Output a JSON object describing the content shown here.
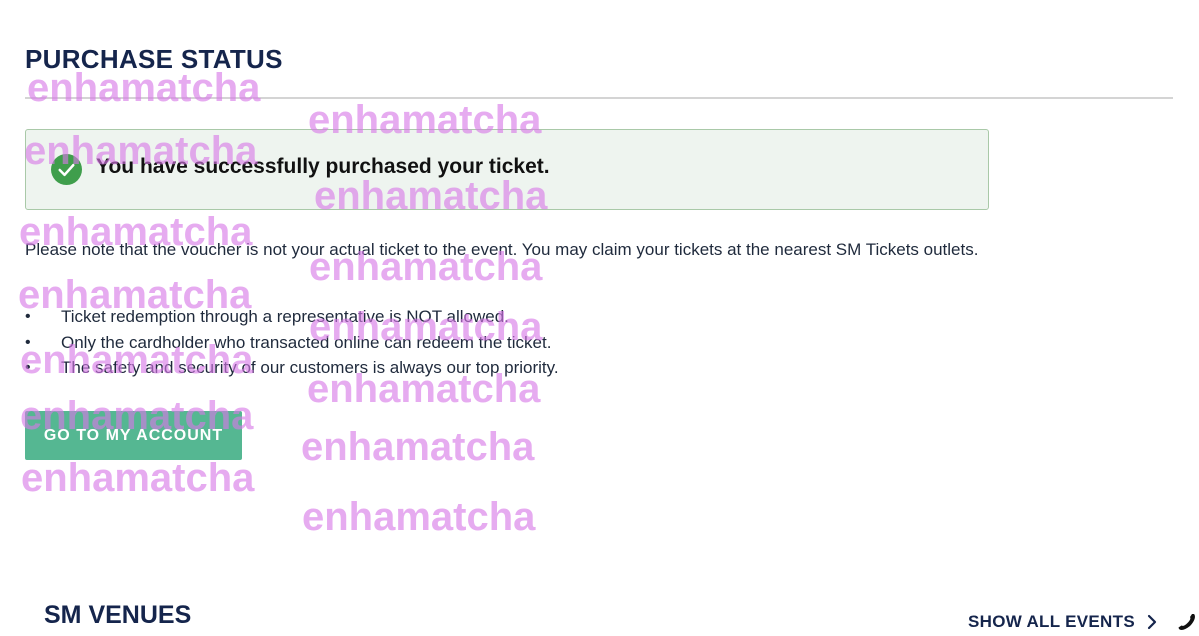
{
  "page": {
    "title": "PURCHASE STATUS"
  },
  "success": {
    "message": "You have successfully purchased your ticket.",
    "icon": "check-circle-icon",
    "color": "#3f9e4c"
  },
  "note": "Please note that the voucher is not your actual ticket to the event. You may claim your tickets at the nearest SM Tickets outlets.",
  "rules": [
    "Ticket redemption through a representative is NOT allowed.",
    "Only the cardholder who transacted online can redeem the ticket.",
    "The safety and security of our customers is always our top priority."
  ],
  "bullet": "•",
  "account_button": {
    "label": "GO TO MY ACCOUNT",
    "color": "#55b792"
  },
  "footer": {
    "venues_title": "SM VENUES",
    "show_all_label": "SHOW ALL EVENTS",
    "chevron_icon": "chevron-right-icon",
    "phone_icon": "phone-icon"
  },
  "watermark": {
    "text": "enhamatcha",
    "color": "#d778e6"
  }
}
